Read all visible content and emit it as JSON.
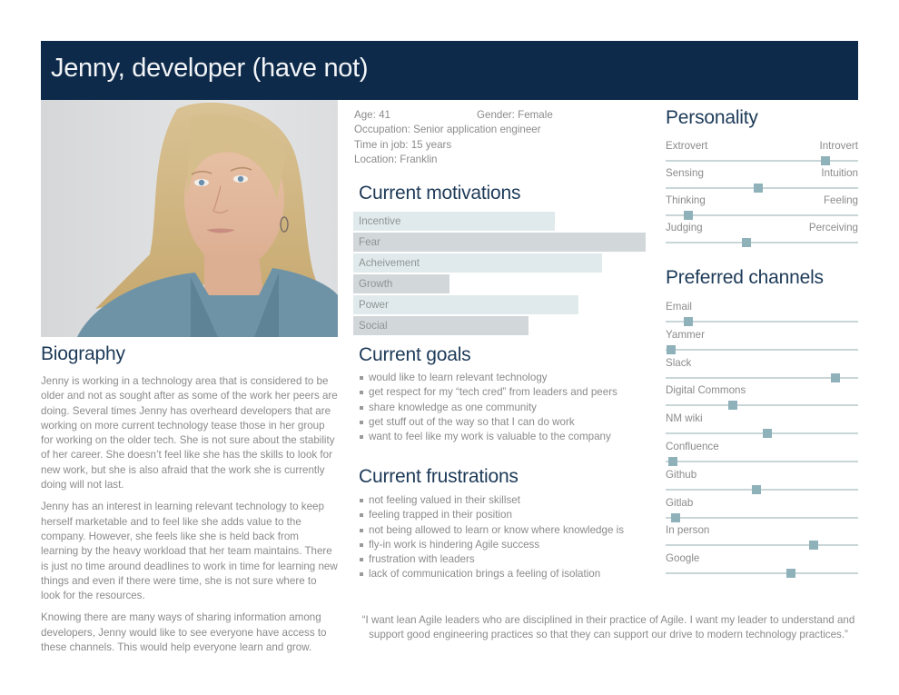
{
  "header": {
    "title": "Jenny, developer (have not)"
  },
  "photo": {
    "alt": "Portrait of Jenny, a woman with blonde hair wearing a blue-grey cardigan"
  },
  "facts": {
    "age": "Age: 41",
    "gender": "Gender: Female",
    "occupation": "Occupation: Senior application engineer",
    "time_in_job": "Time in job: 15 years",
    "location": "Location: Franklin"
  },
  "biography": {
    "title": "Biography",
    "paragraphs": [
      "Jenny is working in a technology area that is considered to be older and not as sought after as some of the work her peers are doing. Several times Jenny has overheard developers that are working on more current technology tease those in her group for working on the older tech. She is not sure about the stability of her career. She doesn’t feel like she has the skills to look for new work, but she is also afraid that the work she is currently doing will not last.",
      "Jenny has an interest in learning relevant technology to keep herself marketable and to feel like she adds value to the company. However, she feels like she is held back from learning by the heavy workload that her team maintains. There is just no time around deadlines to work in time for learning new things and even if there were time, she is not sure where to look for the resources.",
      "Knowing there are many ways of sharing information among developers, Jenny would like to see everyone have access to these channels. This would help everyone learn and grow."
    ]
  },
  "motivations": {
    "title": "Current motivations",
    "items": [
      {
        "label": "Incentive",
        "value": 0.69
      },
      {
        "label": "Fear",
        "value": 1.0
      },
      {
        "label": "Acheivement",
        "value": 0.85
      },
      {
        "label": "Growth",
        "value": 0.33
      },
      {
        "label": "Power",
        "value": 0.77
      },
      {
        "label": "Social",
        "value": 0.6
      }
    ]
  },
  "goals": {
    "title": "Current goals",
    "items": [
      "would like to learn relevant technology",
      "get respect for my “tech cred” from leaders and peers",
      "share knowledge as one community",
      "get stuff out of the way so that I can do work",
      "want to feel like my work is valuable to the company"
    ]
  },
  "frustrations": {
    "title": "Current frustrations",
    "items": [
      "not feeling valued in their skillset",
      "feeling trapped in their position",
      "not being allowed to learn or know where knowledge is",
      "fly-in work is hindering Agile success",
      "frustration with leaders",
      "lack of communication brings a feeling of isolation"
    ]
  },
  "personality": {
    "title": "Personality",
    "scales": [
      {
        "left": "Extrovert",
        "right": "Introvert",
        "value": 0.83
      },
      {
        "left": "Sensing",
        "right": "Intuition",
        "value": 0.48
      },
      {
        "left": "Thinking",
        "right": "Feeling",
        "value": 0.12
      },
      {
        "left": "Judging",
        "right": "Perceiving",
        "value": 0.42
      }
    ]
  },
  "channels": {
    "title": "Preferred channels",
    "items": [
      {
        "label": "Email",
        "value": 0.12
      },
      {
        "label": "Yammer",
        "value": 0.03
      },
      {
        "label": "Slack",
        "value": 0.88
      },
      {
        "label": "Digital Commons",
        "value": 0.35
      },
      {
        "label": "NM wiki",
        "value": 0.53
      },
      {
        "label": "Confluence",
        "value": 0.04
      },
      {
        "label": "Github",
        "value": 0.47
      },
      {
        "label": "Gitlab",
        "value": 0.05
      },
      {
        "label": "In person",
        "value": 0.77
      },
      {
        "label": "Google",
        "value": 0.65
      }
    ]
  },
  "quote": "“I want lean Agile leaders who are disciplined in their practice of Agile. I want my leader to understand and support good engineering practices so that they can support our drive to modern technology practices.”",
  "colors": {
    "header_bg": "#0d2a4a",
    "heading": "#1d3a58",
    "bar_light": "#e0eaec",
    "bar_dark": "#d2d7da",
    "slider_knob": "#8fb2ba",
    "slider_track": "#c9d6d8"
  }
}
